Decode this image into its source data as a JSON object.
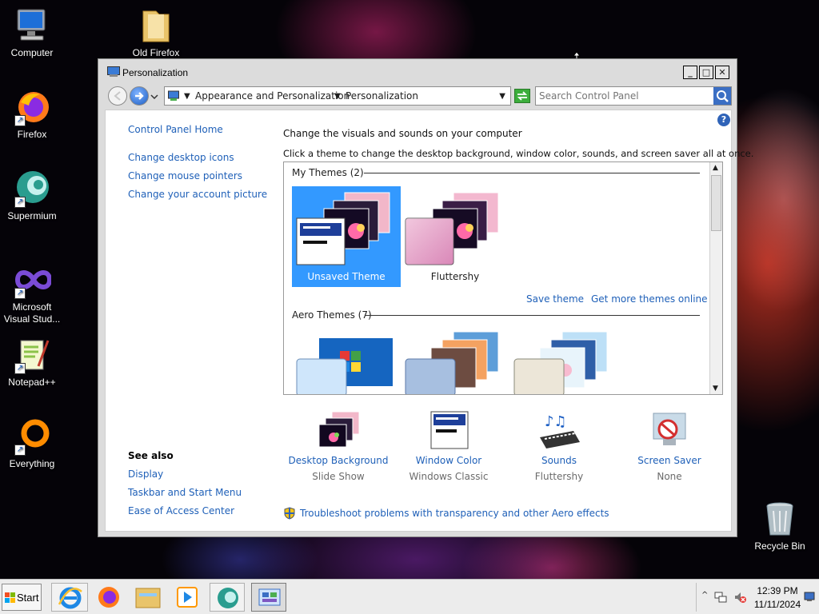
{
  "desktop": {
    "icons": [
      {
        "label": "Computer"
      },
      {
        "label": "Firefox"
      },
      {
        "label": "Supermium"
      },
      {
        "label": "Microsoft Visual Stud..."
      },
      {
        "label": "Notepad++"
      },
      {
        "label": "Everything"
      },
      {
        "label": "Old Firefox"
      },
      {
        "label": "Recycle Bin"
      }
    ]
  },
  "window": {
    "title": "Personalization",
    "minimize_glyph": "_",
    "maximize_glyph": "□",
    "close_glyph": "✕",
    "breadcrumb": [
      "Appearance and Personalization",
      "Personalization"
    ],
    "search_placeholder": "Search Control Panel"
  },
  "sidebar": {
    "home": "Control Panel Home",
    "links": [
      "Change desktop icons",
      "Change mouse pointers",
      "Change your account picture"
    ],
    "see_also_title": "See also",
    "see_also": [
      "Display",
      "Taskbar and Start Menu",
      "Ease of Access Center"
    ]
  },
  "main": {
    "heading": "Change the visuals and sounds on your computer",
    "description": "Click a theme to change the desktop background, window color, sounds, and screen saver all at once.",
    "my_themes_header": "My Themes (2)",
    "my_themes": [
      {
        "name": "Unsaved Theme",
        "selected": true
      },
      {
        "name": "Fluttershy",
        "selected": false
      }
    ],
    "save_theme": "Save theme",
    "get_more": "Get more themes online",
    "aero_header": "Aero Themes (7)",
    "settings": [
      {
        "label": "Desktop Background",
        "value": "Slide Show"
      },
      {
        "label": "Window Color",
        "value": "Windows Classic"
      },
      {
        "label": "Sounds",
        "value": "Fluttershy"
      },
      {
        "label": "Screen Saver",
        "value": "None"
      }
    ],
    "troubleshoot": "Troubleshoot problems with transparency and other Aero effects"
  },
  "taskbar": {
    "start_label": "Start",
    "time": "12:39 PM",
    "date": "11/11/2024"
  },
  "colors": {
    "link": "#1f60b8",
    "selection": "#3399ff"
  }
}
